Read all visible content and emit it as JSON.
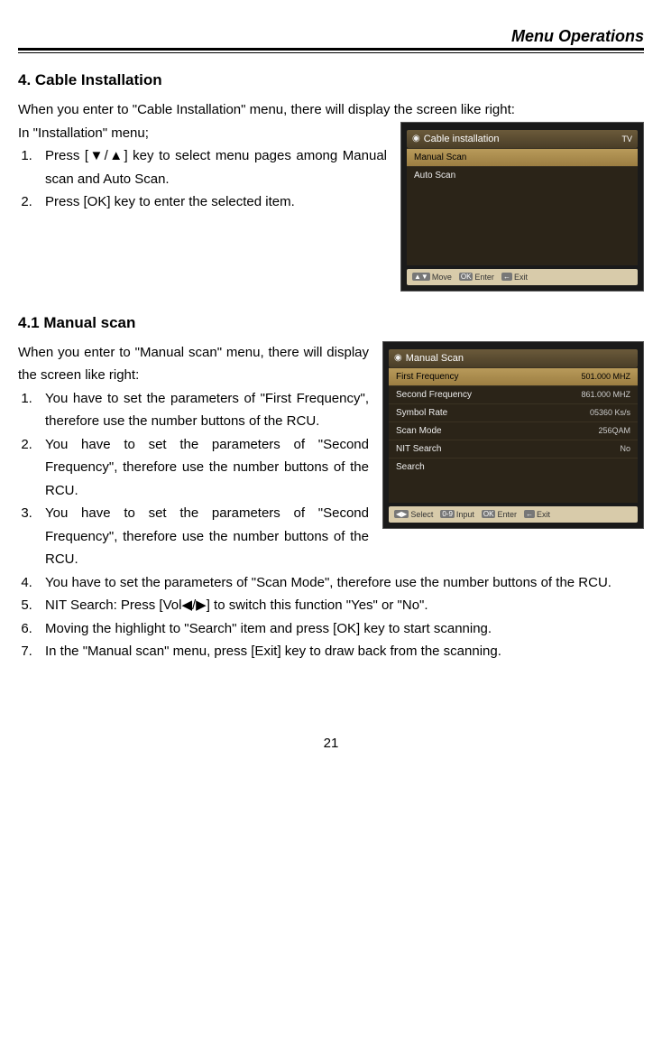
{
  "header": {
    "title": "Menu Operations"
  },
  "section4": {
    "heading": "4.   Cable Installation",
    "intro": "When you enter to \"Cable Installation\" menu, there will display the screen like right:",
    "intro2": "In \"Installation\" menu;",
    "list": [
      "Press [▼/▲] key to select menu pages among Manual scan and Auto Scan.",
      "Press [OK] key to enter the selected item."
    ],
    "shot": {
      "title": "Cable installation",
      "tag": "TV",
      "items": [
        "Manual Scan",
        "Auto Scan"
      ],
      "footer": [
        {
          "key": "▲▼",
          "label": "Move"
        },
        {
          "key": "OK",
          "label": "Enter"
        },
        {
          "key": "←",
          "label": "Exit"
        }
      ]
    }
  },
  "section41": {
    "heading": "4.1   Manual scan",
    "intro": "When you enter to \"Manual scan\" menu, there will display the screen like right:",
    "list": [
      "You have to set the parameters of \"First Frequency\", therefore use the number buttons of the RCU.",
      "You have to set the parameters of \"Second Frequency\", therefore use the number buttons of the RCU.",
      "You have to set the parameters of \"Second Frequency\", therefore use the number buttons of the RCU.",
      "You have to set the parameters of \"Scan Mode\", therefore use the number buttons of the RCU.",
      "NIT Search: Press [Vol◀/▶] to switch this function \"Yes\" or \"No\".",
      "Moving the highlight to \"Search\" item and press [OK] key to start scanning.",
      "In the \"Manual scan\" menu, press [Exit] key to draw back from the scanning."
    ],
    "shot": {
      "title": "Manual Scan",
      "rows": [
        {
          "label": "First Frequency",
          "value": "501.000 MHZ",
          "sel": true
        },
        {
          "label": "Second Frequency",
          "value": "861.000 MHZ",
          "sel": false
        },
        {
          "label": "Symbol Rate",
          "value": "05360  Ks/s",
          "sel": false
        },
        {
          "label": "Scan Mode",
          "value": "256QAM",
          "sel": false
        },
        {
          "label": "NIT Search",
          "value": "No",
          "sel": false
        },
        {
          "label": "Search",
          "value": "",
          "sel": false
        }
      ],
      "footer": [
        {
          "key": "◀▶",
          "label": "Select"
        },
        {
          "key": "0-9",
          "label": "Input"
        },
        {
          "key": "OK",
          "label": "Enter"
        },
        {
          "key": "←",
          "label": "Exit"
        }
      ]
    }
  },
  "page_number": "21"
}
